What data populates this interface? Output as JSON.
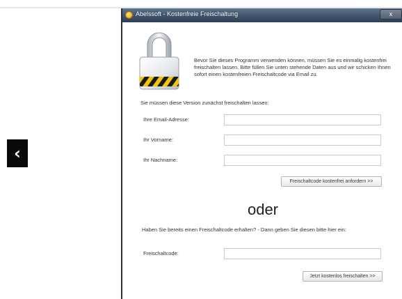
{
  "window": {
    "title": "Abelssoft - Kostenfreie Freischaltung",
    "close_label": "x"
  },
  "nav": {
    "back_label": "‹"
  },
  "intro": {
    "text": "Bevor Sie dieses Programm verwenden können, müssen Sie es einmalig kostenfrei freischalten lassen. Bitte füllen Sie unten stehende Daten aus und wir schicken Ihnen sofort einen kostenfreien Freischaltcode via Email zu."
  },
  "version_note": "Sie müssen diese Version zunächst freischalten lassen:",
  "form": {
    "email_label": "Ihre Email-Adresse:",
    "email_value": "",
    "firstname_label": "Ihr Vorname:",
    "firstname_value": "",
    "lastname_label": "Ihr Nachname:",
    "lastname_value": "",
    "request_button": "Freischaltcode kostenfrei anfordern >>"
  },
  "or_label": "oder",
  "code_section": {
    "question": "Haben Sie bereits einen Freischaltcode erhalten? - Dann geben Sie diesen bitte hier ein:",
    "code_label": "Freischaltcode:",
    "code_value": "",
    "unlock_button": "Jetzt kostenlos freischalten >>"
  },
  "icons": {
    "lock": "padlock-icon",
    "title": "abelssoft-logo-icon",
    "back": "chevron-left-icon"
  },
  "colors": {
    "titlebar": "#3f546d",
    "lock_stripe_yellow": "#f2c40e",
    "lock_stripe_black": "#1a1a1a",
    "field_border": "#c5cbd3"
  }
}
